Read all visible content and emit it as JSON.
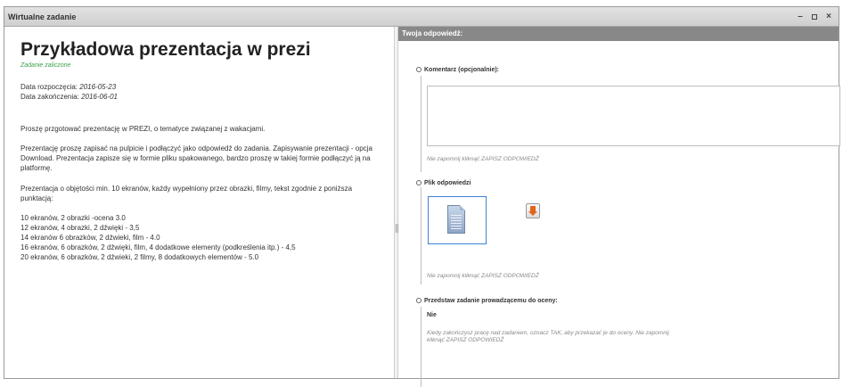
{
  "window": {
    "title": "Wirtualne zadanie"
  },
  "task": {
    "title": "Przykładowa prezentacja w prezi",
    "status": "Zadanie zaliczone",
    "start_label": "Data rozpoczęcia:",
    "start_value": "2016-05-23",
    "end_label": "Data zakończenia:",
    "end_value": "2016-06-01",
    "paragraph1": "Proszę przgotować prezentację w PREZI, o tematyce związanej z wakacjami.",
    "paragraph2": "Prezentację proszę zapisać na pulpicie i podłączyć jako odpowiedź do zadania. Zapisywanie prezentacji - opcja Download. Prezentacja zapisze się w formie pliku spakowanego, bardzo proszę w takiej formie podłączyć ją na platformę.",
    "paragraph3": "Prezentacja o objętości min. 10 ekranów, każdy wypełniony przez obrazki, filmy, tekst zgodnie z poniższa punktacją:",
    "scoring": [
      "10 ekranów, 2 obrazki -ocena 3.0",
      "12 ekranów, 4 obrazki, 2 dźwięki - 3,5",
      "14 ekranów 6 obrazków, 2 dźwieki, film - 4.0",
      "16 ekranów, 6 obrazków, 2 dźwięki, film, 4 dodatkowe elementy (podkreślenia itp.) - 4,5",
      "20 ekranów, 6 obrazków, 2 dźwieki, 2 filmy, 8 dodatkowych elementów - 5.0"
    ]
  },
  "answer": {
    "header": "Twoja odpowiedź:",
    "comment_label": "Komentarz (opcjonalnie):",
    "comment_value": "",
    "comment_hint": "Nie zapomnij kliknąć ZAPISZ ODPOWIEDŹ",
    "file_label": "Plik odpowiedzi",
    "file_hint": "Nie zapomnij kliknąć ZAPISZ ODPOWIEDŹ",
    "submit_label": "Przedstaw zadanie prowadzącemu do oceny:",
    "submit_value": "Nie",
    "submit_hint": "Kiedy zakończysz pracę nad zadaniem, oznacz TAK, aby przekazać je do oceny. Nie zapomnij kliknąć ZAPISZ ODPOWIEDŹ"
  },
  "icons": {
    "minimize": "minimize-icon",
    "maximize": "maximize-icon",
    "close": "close-icon",
    "file": "document-icon",
    "download": "download-icon"
  },
  "colors": {
    "status": "#3aa24a",
    "header_bg": "#888888",
    "file_border": "#3a82d8",
    "download_arrow": "#e2661a"
  }
}
